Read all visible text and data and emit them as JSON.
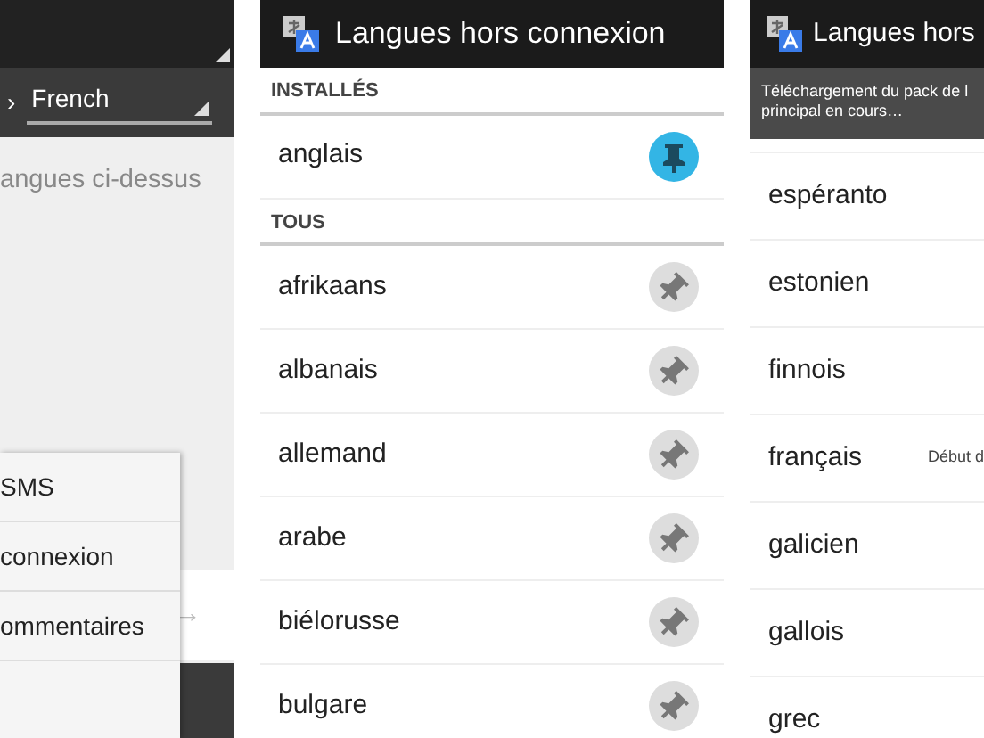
{
  "left_screen": {
    "source_chevron": "›",
    "target_language": "French",
    "hint": "angues ci-dessus",
    "menu_items": [
      "SMS",
      "connexion",
      "ommentaires"
    ],
    "arrow": "→"
  },
  "middle_screen": {
    "title": "Langues hors connexion",
    "sections": [
      {
        "header": "INSTALLÉS",
        "languages": [
          {
            "name": "anglais",
            "installed": true
          }
        ]
      },
      {
        "header": "TOUS",
        "languages": [
          {
            "name": "afrikaans",
            "installed": false
          },
          {
            "name": "albanais",
            "installed": false
          },
          {
            "name": "allemand",
            "installed": false
          },
          {
            "name": "arabe",
            "installed": false
          },
          {
            "name": "biélorusse",
            "installed": false
          },
          {
            "name": "bulgare",
            "installed": false
          }
        ]
      }
    ]
  },
  "right_screen": {
    "title": "Langues hors",
    "banner_lines": [
      "Téléchargement du pack de l",
      "principal en cours…"
    ],
    "languages": [
      {
        "name": "espéranto"
      },
      {
        "name": "estonien"
      },
      {
        "name": "finnois"
      },
      {
        "name": "français",
        "status": "Début d"
      },
      {
        "name": "galicien"
      },
      {
        "name": "gallois"
      },
      {
        "name": "grec"
      }
    ]
  }
}
